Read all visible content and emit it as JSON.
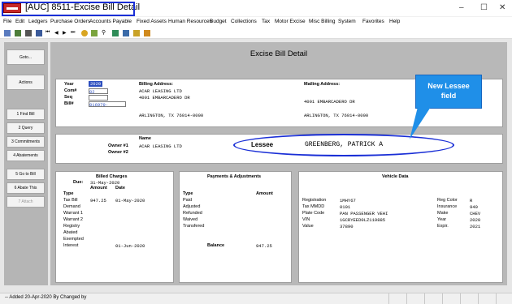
{
  "window": {
    "title": "[AUC] 8511-Excise Bill Detail",
    "minimize": "–",
    "maximize": "☐",
    "close": "✕"
  },
  "menu": [
    "File",
    "Edit",
    "Ledgers",
    "Purchase Orders",
    "Accounts Payable",
    "Fixed Assets",
    "Human Resources",
    "Budget",
    "Collections",
    "Tax",
    "Motor Excise",
    "Misc Billing",
    "System",
    "Favorites",
    "Help"
  ],
  "sidebar": {
    "buttons": [
      "Goto...",
      "Actions",
      "1 Find Bill",
      "2 Query",
      "3 Commitments",
      "4 Abatements",
      "5 Go to Bill",
      "6 Abate This",
      "7 Attach"
    ]
  },
  "page": {
    "heading": "Excise Bill Detail"
  },
  "bill": {
    "year_label": "Year",
    "year": "2020",
    "com_label": "Com#",
    "com": "02",
    "seq_label": "Seq",
    "seq": "",
    "billnum_label": "Bill#",
    "billnum": "016979-",
    "billing_label": "Billing Address:",
    "billing_line1": "ACAR LEASING LTD",
    "billing_line2": "4001 EMBARCADERO DR",
    "billing_city": "ARLINGTON, TX 76014-0000",
    "mailing_label": "Mailing Address:",
    "mailing_line1": "4001 EMBARCADERO DR",
    "mailing_city": "ARLINGTON, TX 76014-0000"
  },
  "owner": {
    "name_label": "Name",
    "owner1_label": "Owner #1",
    "owner1": "ACAR LEASING LTD",
    "owner2_label": "Owner #2",
    "lessee_label": "Lessee",
    "lessee": "GREENBERG, PATRICK A"
  },
  "callout": {
    "line1": "New Lessee",
    "line2": "field"
  },
  "billed": {
    "title": "Billed Charges",
    "due_label": "Due:",
    "due": "31-May-2020",
    "col_type": "Type",
    "col_amount": "Amount",
    "col_date": "Date",
    "rows": [
      {
        "type": "Tax Bill",
        "amount": "947.25",
        "date": "01-May-2020"
      },
      {
        "type": "Demand",
        "amount": "",
        "date": ""
      },
      {
        "type": "Warrant 1",
        "amount": "",
        "date": ""
      },
      {
        "type": "Warrant 2",
        "amount": "",
        "date": ""
      },
      {
        "type": "Registry",
        "amount": "",
        "date": ""
      },
      {
        "type": "Abated",
        "amount": "",
        "date": ""
      },
      {
        "type": "Exempted",
        "amount": "",
        "date": ""
      },
      {
        "type": "Interest",
        "amount": "",
        "date": "01-Jun-2020"
      }
    ]
  },
  "payments": {
    "title": "Payments & Adjustments",
    "col_type": "Type",
    "col_amount": "Amount",
    "rows": [
      "Paid",
      "Adjusted",
      "Refunded",
      "Waived",
      "Transfered"
    ],
    "balance_label": "Balance",
    "balance": "947.25"
  },
  "vehicle": {
    "title": "Vehicle Data",
    "left": [
      {
        "label": "Registration",
        "value": "1MHY67"
      },
      {
        "label": "Tax MMDD",
        "value": "0101"
      },
      {
        "label": "Plate Code",
        "value": "PAN PASSENGER VEHI"
      },
      {
        "label": "VIN",
        "value": "1GCRYEED0LZ119885"
      },
      {
        "label": "Value",
        "value": "37890"
      }
    ],
    "right": [
      {
        "label": "Reg Color",
        "value": "R"
      },
      {
        "label": "Insurance",
        "value": "940"
      },
      {
        "label": "Make",
        "value": "CHEV"
      },
      {
        "label": "Year",
        "value": "2020"
      },
      {
        "label": "Expir.",
        "value": "2021"
      }
    ]
  },
  "status": {
    "text": "-- Added 20-Apr-2020 By  Changed by"
  }
}
